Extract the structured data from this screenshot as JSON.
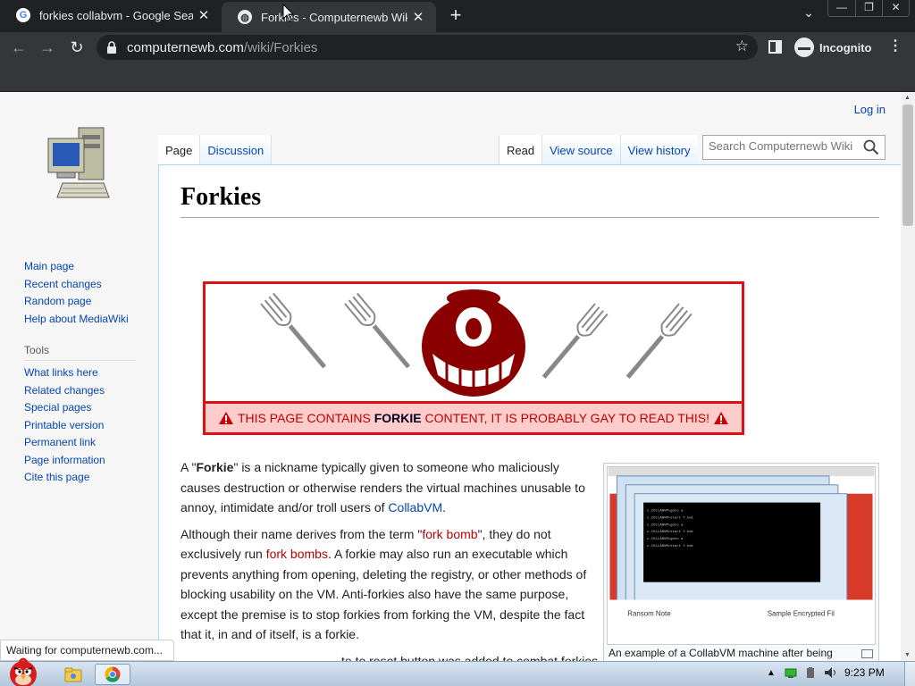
{
  "browser": {
    "tabs": [
      {
        "title": "forkies collabvm - Google Search",
        "active": false
      },
      {
        "title": "Forkies - Computernewb Wiki",
        "active": true
      }
    ],
    "new_tab": "+",
    "url_host": "computernewb.com",
    "url_path": "/wiki/Forkies",
    "profile_label": "Incognito"
  },
  "wiki": {
    "login": "Log in",
    "tabs_left": [
      "Page",
      "Discussion"
    ],
    "tabs_right": [
      "Read",
      "View source",
      "View history"
    ],
    "search_placeholder": "Search Computernewb Wiki",
    "nav": [
      "Main page",
      "Recent changes",
      "Random page",
      "Help about MediaWiki"
    ],
    "tools_header": "Tools",
    "tools": [
      "What links here",
      "Related changes",
      "Special pages",
      "Printable version",
      "Permanent link",
      "Page information",
      "Cite this page"
    ],
    "title": "Forkies",
    "banner": {
      "warning_pre": "THIS PAGE CONTAINS ",
      "warning_bold": "FORKIE",
      "warning_post": " CONTENT, IT IS PROBABLY GAY TO READ THIS!"
    },
    "para1": {
      "a": "A \"",
      "b": "Forkie",
      "c": "\" is a nickname typically given to someone who maliciously causes destruction or otherwise renders the virtual machines unusable to annoy, intimidate and/or troll users of ",
      "link": "CollabVM",
      "d": "."
    },
    "para2": {
      "a": "Although their name derives from the term \"",
      "link1": "fork bomb",
      "b": "\", they do not exclusively run ",
      "link2": "fork bombs",
      "c": ". A forkie may also run an executable which prevents anything from opening, deleting the registry, or other methods of blocking usability on the VM. Anti-forkies also have the same purpose, except the premise is to stop forkies from forking the VM, despite the fact that it, in and of itself, is a forkie."
    },
    "para3_tail": "te to reset button was added to combat forkies",
    "thumb_caption": "An example of a CollabVM machine after being"
  },
  "status_bar": "Waiting for computernewb.com...",
  "taskbar": {
    "clock": "9:23 PM"
  }
}
